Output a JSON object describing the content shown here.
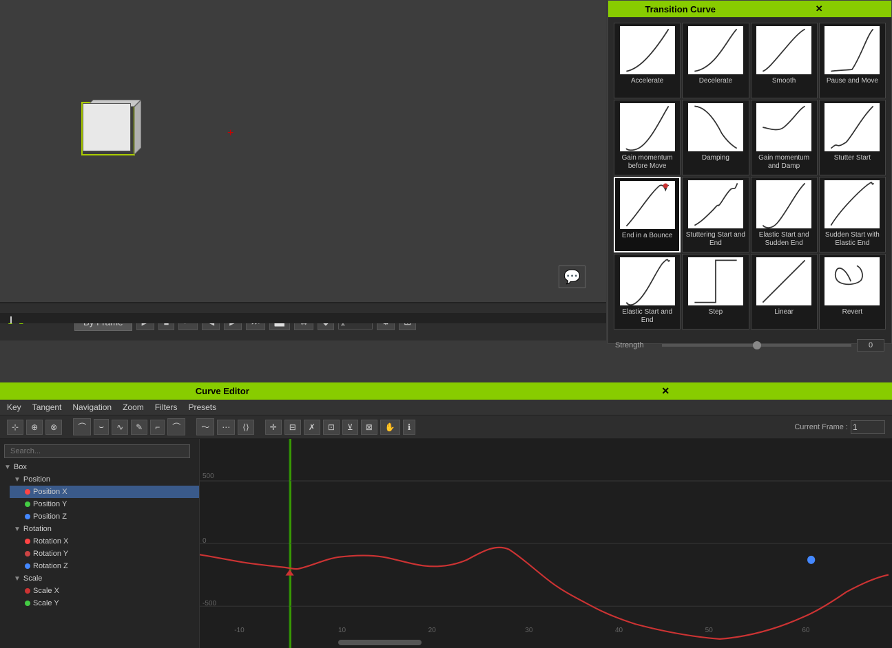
{
  "transition_panel": {
    "title": "Transition Curve",
    "close": "✕",
    "curves": [
      {
        "id": "accelerate",
        "label": "Accelerate",
        "selected": false
      },
      {
        "id": "decelerate",
        "label": "Decelerate",
        "selected": false
      },
      {
        "id": "smooth",
        "label": "Smooth",
        "selected": false
      },
      {
        "id": "pause-and-move",
        "label": "Pause and Move",
        "selected": false
      },
      {
        "id": "gain-momentum-before-move",
        "label": "Gain momentum before Move",
        "selected": false
      },
      {
        "id": "damping",
        "label": "Damping",
        "selected": false
      },
      {
        "id": "gain-momentum-and-damp",
        "label": "Gain momentum and Damp",
        "selected": false
      },
      {
        "id": "stutter-start",
        "label": "Stutter Start",
        "selected": false
      },
      {
        "id": "end-in-a-bounce",
        "label": "End in a Bounce",
        "selected": true
      },
      {
        "id": "stuttering-start-and-end",
        "label": "Stuttering Start and End",
        "selected": false
      },
      {
        "id": "elastic-start-and-sudden-end",
        "label": "Elastic Start and Sudden End",
        "selected": false
      },
      {
        "id": "sudden-start-with-elastic-end",
        "label": "Sudden Start with Elastic End",
        "selected": false
      },
      {
        "id": "elastic-start-and-end",
        "label": "Elastic Start and End",
        "selected": false
      },
      {
        "id": "step",
        "label": "Step",
        "selected": false
      },
      {
        "id": "linear",
        "label": "Linear",
        "selected": false
      },
      {
        "id": "revert",
        "label": "Revert",
        "selected": false
      }
    ],
    "strength_label": "Strength",
    "strength_value": "0"
  },
  "timeline": {
    "by_frame": "By Frame",
    "frame_value": "1",
    "current_frame_label": "Current Frame :"
  },
  "curve_editor": {
    "title": "Curve Editor",
    "close": "✕",
    "menus": [
      "Key",
      "Tangent",
      "Navigation",
      "Zoom",
      "Filters",
      "Presets"
    ],
    "current_frame_label": "Current Frame :",
    "current_frame_value": "1",
    "search_placeholder": "Search...",
    "tree": [
      {
        "label": "Box",
        "expanded": true,
        "children": [
          {
            "label": "Position",
            "expanded": true,
            "children": [
              {
                "label": "Position X",
                "color": "#ff4444",
                "selected": true
              },
              {
                "label": "Position Y",
                "color": "#44cc44",
                "selected": false
              },
              {
                "label": "Position Z",
                "color": "#4488ff",
                "selected": false
              }
            ]
          },
          {
            "label": "Rotation",
            "expanded": true,
            "children": [
              {
                "label": "Rotation X",
                "color": "#ff4444",
                "selected": false
              },
              {
                "label": "Rotation Y",
                "color": "#cc4444",
                "selected": false
              },
              {
                "label": "Rotation Z",
                "color": "#4488ff",
                "selected": false
              }
            ]
          },
          {
            "label": "Scale",
            "expanded": true,
            "children": [
              {
                "label": "Scale X",
                "color": "#cc3333",
                "selected": false
              },
              {
                "label": "Scale Y",
                "color": "#44cc44",
                "selected": false
              }
            ]
          }
        ]
      }
    ],
    "graph_labels_x": [
      "-10",
      "10",
      "20",
      "30",
      "40",
      "50",
      "60"
    ],
    "graph_labels_y": [
      "500",
      "0",
      "-500"
    ]
  }
}
